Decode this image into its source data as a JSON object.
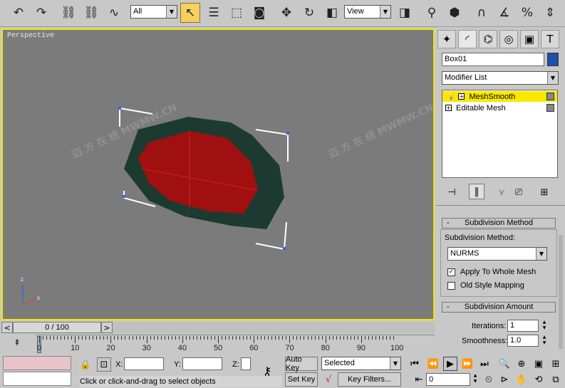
{
  "toolbar": {
    "filter_value": "All",
    "view_value": "View",
    "icons": [
      "undo-icon",
      "redo-icon",
      "link-icon",
      "unlink-icon",
      "bind-spacewarp-icon",
      "select-icon",
      "select-by-name-icon",
      "rect-region-icon",
      "window-crossing-icon",
      "move-icon",
      "rotate-icon",
      "scale-icon",
      "mirror-icon",
      "align-icon",
      "snap-icon",
      "angle-snap-icon",
      "percent-snap-icon",
      "spinner-snap-icon"
    ]
  },
  "viewport": {
    "label": "Perspective",
    "axis_z": "z",
    "axis_x": "x"
  },
  "panel": {
    "object_name": "Box01",
    "object_color": "#1f4fa8",
    "modifier_list": "Modifier List",
    "stack": [
      {
        "label": "MeshSmooth",
        "selected": true
      },
      {
        "label": "Editable Mesh",
        "selected": false
      }
    ],
    "subdivision_method": {
      "title": "Subdivision Method",
      "field_label": "Subdivision Method:",
      "value": "NURMS",
      "apply_whole": "Apply To Whole Mesh",
      "apply_whole_checked": true,
      "old_style": "Old Style Mapping",
      "old_style_checked": false
    },
    "subdivision_amount": {
      "title": "Subdivision Amount",
      "iterations_label": "Iterations:",
      "iterations_value": "1",
      "smoothness_label": "Smoothness:",
      "smoothness_value": "1.0"
    },
    "collapse_marker": "-"
  },
  "timeline": {
    "frame_display": "0 / 100",
    "ticks": [
      "0",
      "10",
      "20",
      "30",
      "40",
      "50",
      "60",
      "70",
      "80",
      "90",
      "100"
    ]
  },
  "status": {
    "x_label": "X:",
    "y_label": "Y:",
    "z_label": "Z:",
    "auto_key": "Auto Key",
    "set_key": "Set Key",
    "selected_option": "Selected",
    "key_filters": "Key Filters...",
    "frame_value": "0",
    "prompt": "Click or click-and-drag to select objects"
  },
  "colors": {
    "viewport_bg": "#7b7b7b",
    "active_border": "#f2e600",
    "mesh_face": "#a01010",
    "mesh_edge": "#1d3a30",
    "stack_highlight": "#f8e800"
  }
}
